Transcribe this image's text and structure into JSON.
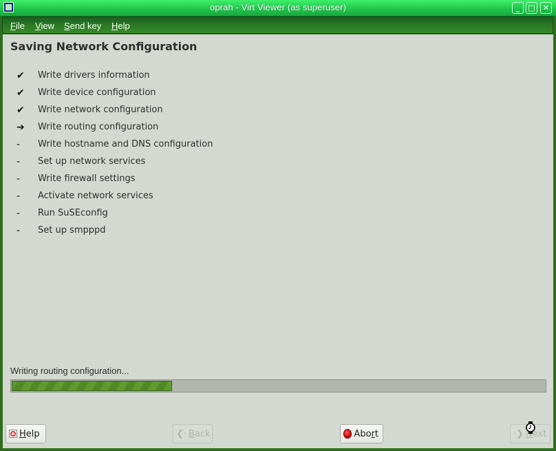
{
  "window": {
    "title": "oprah - Virt Viewer (as superuser)",
    "controls": [
      "minimize",
      "maximize",
      "close"
    ]
  },
  "menubar": {
    "items": [
      {
        "label": "File",
        "mnemonic": "F",
        "rest": "ile"
      },
      {
        "label": "View",
        "mnemonic": "V",
        "rest": "iew"
      },
      {
        "label": "Send key",
        "mnemonic": "S",
        "rest": "end key"
      },
      {
        "label": "Help",
        "mnemonic": "H",
        "rest": "elp"
      }
    ]
  },
  "page": {
    "title": "Saving Network Configuration",
    "steps": [
      {
        "status": "done",
        "mark": "✔",
        "label": "Write drivers information"
      },
      {
        "status": "done",
        "mark": "✔",
        "label": "Write device configuration"
      },
      {
        "status": "done",
        "mark": "✔",
        "label": "Write network configuration"
      },
      {
        "status": "current",
        "mark": "➔",
        "label": "Write routing configuration"
      },
      {
        "status": "pending",
        "mark": "-",
        "label": "Write hostname and DNS configuration"
      },
      {
        "status": "pending",
        "mark": "-",
        "label": "Set up network services"
      },
      {
        "status": "pending",
        "mark": "-",
        "label": "Write firewall settings"
      },
      {
        "status": "pending",
        "mark": "-",
        "label": "Activate network services"
      },
      {
        "status": "pending",
        "mark": "-",
        "label": "Run SuSEconfig"
      },
      {
        "status": "pending",
        "mark": "-",
        "label": "Set up smpppd"
      }
    ],
    "status_text": "Writing routing configuration...",
    "progress_percent": 30
  },
  "buttons": {
    "help": {
      "label": "Help",
      "mnemonic": "H",
      "rest": "elp",
      "enabled": true
    },
    "back": {
      "label": "Back",
      "mnemonic": "B",
      "rest": "ack",
      "enabled": false
    },
    "abort": {
      "label": "Abort",
      "pre": "Abo",
      "mnemonic": "r",
      "rest": "t",
      "enabled": true
    },
    "next": {
      "label": "Next",
      "mnemonic": "N",
      "rest": "ext",
      "enabled": false
    }
  },
  "colors": {
    "titlebar": "#1fc24a",
    "menubar": "#2a7a24",
    "content_bg": "#d3d9d0",
    "progress_fill": "#5e9a2e",
    "abort_red": "#c00000"
  }
}
